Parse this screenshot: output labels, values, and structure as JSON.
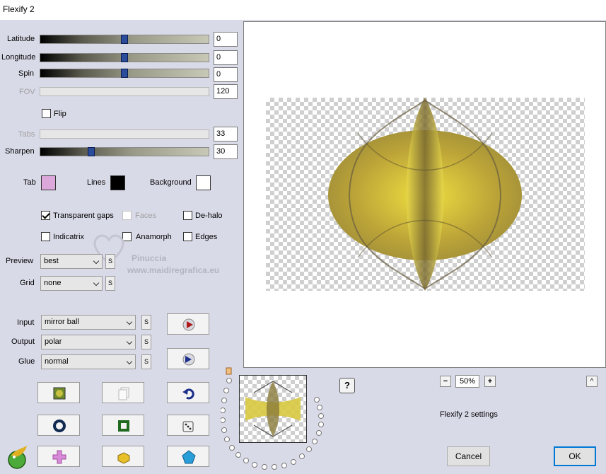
{
  "window": {
    "title": "Flexify 2"
  },
  "params": {
    "latitude": {
      "label": "Latitude",
      "value": "0",
      "level": 0.5,
      "enabled": true
    },
    "longitude": {
      "label": "Longitude",
      "value": "0",
      "level": 0.5,
      "enabled": true
    },
    "spin": {
      "label": "Spin",
      "value": "0",
      "level": 0.5,
      "enabled": true
    },
    "fov": {
      "label": "FOV",
      "value": "120",
      "enabled": false
    },
    "flip": {
      "label": "Flip",
      "checked": false
    },
    "tabs": {
      "label": "Tabs",
      "value": "33",
      "enabled": false
    },
    "sharpen": {
      "label": "Sharpen",
      "value": "30",
      "level": 0.3,
      "enabled": true
    }
  },
  "colors": {
    "tab": {
      "label": "Tab",
      "color": "#dca8dc"
    },
    "lines": {
      "label": "Lines",
      "color": "#000000"
    },
    "background": {
      "label": "Background",
      "color": "#ffffff"
    }
  },
  "options": {
    "transparent_gaps": {
      "label": "Transparent gaps",
      "checked": true
    },
    "faces": {
      "label": "Faces",
      "checked": false,
      "enabled": false
    },
    "de_halo": {
      "label": "De-halo",
      "checked": false
    },
    "indicatrix": {
      "label": "Indicatrix",
      "checked": false
    },
    "anamorph": {
      "label": "Anamorph",
      "checked": false
    },
    "edges": {
      "label": "Edges",
      "checked": false
    }
  },
  "preview_quality": {
    "label": "Preview",
    "value": "best"
  },
  "grid": {
    "label": "Grid",
    "value": "none"
  },
  "input": {
    "label": "Input",
    "value": "mirror ball"
  },
  "output": {
    "label": "Output",
    "value": "polar"
  },
  "glue": {
    "label": "Glue",
    "value": "normal"
  },
  "s_label": "S",
  "watermark": {
    "line1": "Pinuccia",
    "line2": "www.maidiregrafica.eu"
  },
  "zoom": {
    "minus": "−",
    "value": "50%",
    "plus": "+"
  },
  "help_label": "?",
  "expand_label": "^",
  "settings_label": "Flexify 2 settings",
  "buttons": {
    "cancel": "Cancel",
    "ok": "OK"
  }
}
